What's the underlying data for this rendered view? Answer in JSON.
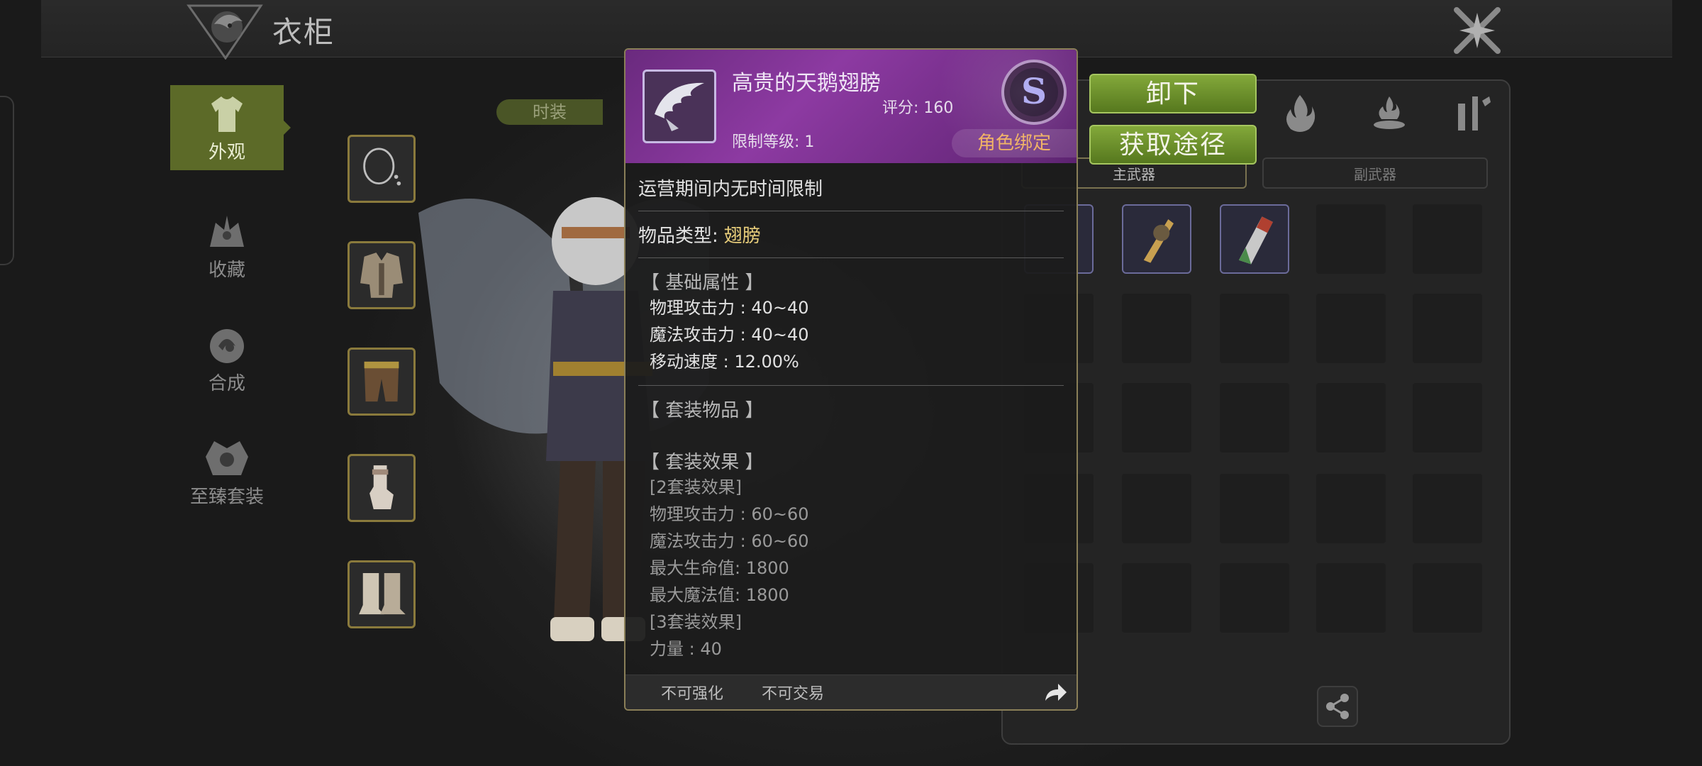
{
  "header": {
    "title": "衣柜"
  },
  "nav": [
    {
      "label": "外观",
      "icon": "outfit-icon",
      "active": true
    },
    {
      "label": "收藏",
      "icon": "collection-icon",
      "active": false
    },
    {
      "label": "合成",
      "icon": "synthesis-icon",
      "active": false
    },
    {
      "label": "至臻套装",
      "icon": "premium-set-icon",
      "active": false
    }
  ],
  "tab": {
    "label": "时装"
  },
  "slots": [
    {
      "icon": "necklace-icon"
    },
    {
      "icon": "coat-icon"
    },
    {
      "icon": "pants-icon"
    },
    {
      "icon": "glove-icon"
    },
    {
      "icon": "boots-icon"
    }
  ],
  "actions": {
    "unequip": "卸下",
    "obtain": "获取途径"
  },
  "weapon_tabs": {
    "main": "主武器",
    "sub": "副武器"
  },
  "popup": {
    "item_name": "高贵的天鹅翅膀",
    "score": "评分: 160",
    "level_limit": "限制等级: 1",
    "grade": "S",
    "bind": "角色绑定",
    "time_limit": "运营期间内无时间限制",
    "type_label": "物品类型:",
    "type_value": "翅膀",
    "base_title": "【 基础属性 】",
    "base_attrs": [
      "物理攻击力 : 40~40",
      "魔法攻击力 : 40~40",
      "移动速度 : 12.00%"
    ],
    "set_items_title": "【 套装物品 】",
    "set_effect_title": "【 套装效果 】",
    "set2_title": "[2套装效果]",
    "set2_attrs": [
      "物理攻击力 : 60~60",
      "魔法攻击力 : 60~60",
      "最大生命值:   1800",
      "最大魔法值:   1800"
    ],
    "set3_title": "[3套装效果]",
    "set3_partial": "力量 : 40",
    "footer": {
      "no_enhance": "不可强化",
      "no_trade": "不可交易"
    }
  },
  "colors": {
    "accent_green": "#6a8f2a",
    "header_purple": "#8d3aa2",
    "bind_orange": "#f0b060",
    "type_gold": "#e6cc7a"
  }
}
